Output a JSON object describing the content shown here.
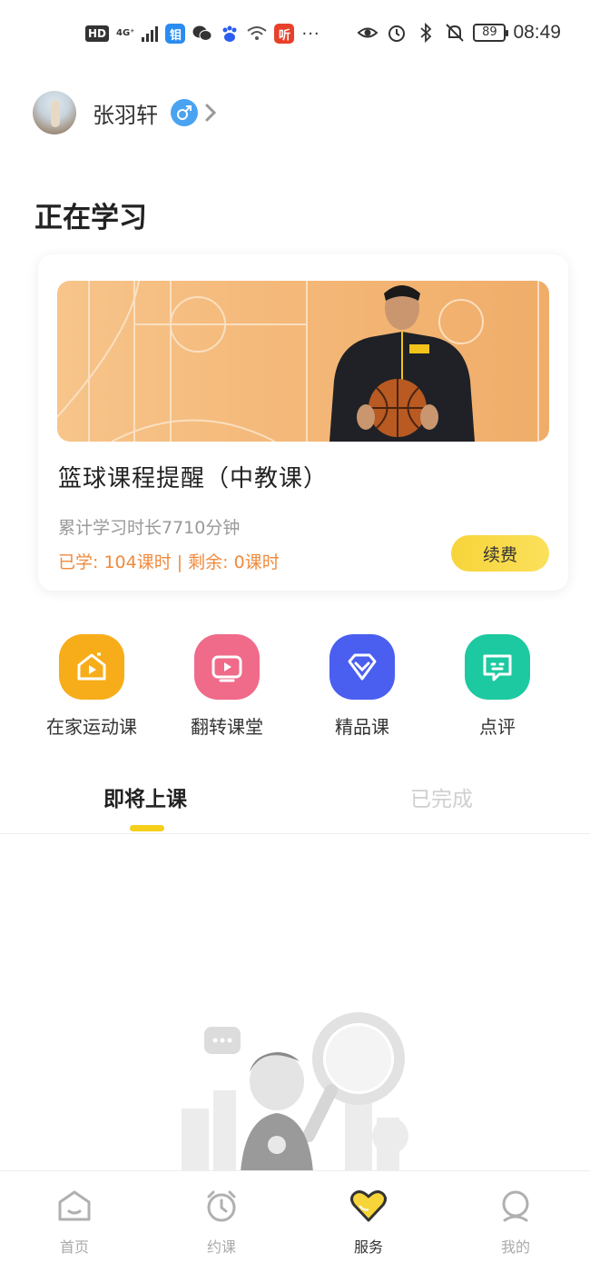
{
  "status_bar": {
    "network": "4G⁺",
    "battery": "89",
    "time": "08:49"
  },
  "profile": {
    "name": "张羽轩"
  },
  "section_title": "正在学习",
  "course": {
    "name": "篮球课程提醒（中教课）",
    "total_time": "累计学习时长7710分钟",
    "progress": "已学: 104课时 | 剩余: 0课时",
    "renew_label": "续费"
  },
  "quick_actions": [
    {
      "label": "在家运动课",
      "color": "#f7ad1a",
      "icon": "home-play-icon"
    },
    {
      "label": "翻转课堂",
      "color": "#f06a8a",
      "icon": "tv-play-icon"
    },
    {
      "label": "精品课",
      "color": "#4a5ef0",
      "icon": "diamond-icon"
    },
    {
      "label": "点评",
      "color": "#1cc9a0",
      "icon": "comment-icon"
    }
  ],
  "tabs": {
    "upcoming": "即将上课",
    "completed": "已完成"
  },
  "bottom_nav": [
    {
      "label": "首页",
      "icon": "home-icon"
    },
    {
      "label": "约课",
      "icon": "alarm-clock-icon"
    },
    {
      "label": "服务",
      "icon": "heart-icon"
    },
    {
      "label": "我的",
      "icon": "profile-icon"
    }
  ],
  "colors": {
    "accent": "#f5cf1a",
    "progress_text": "#f08a3c"
  }
}
